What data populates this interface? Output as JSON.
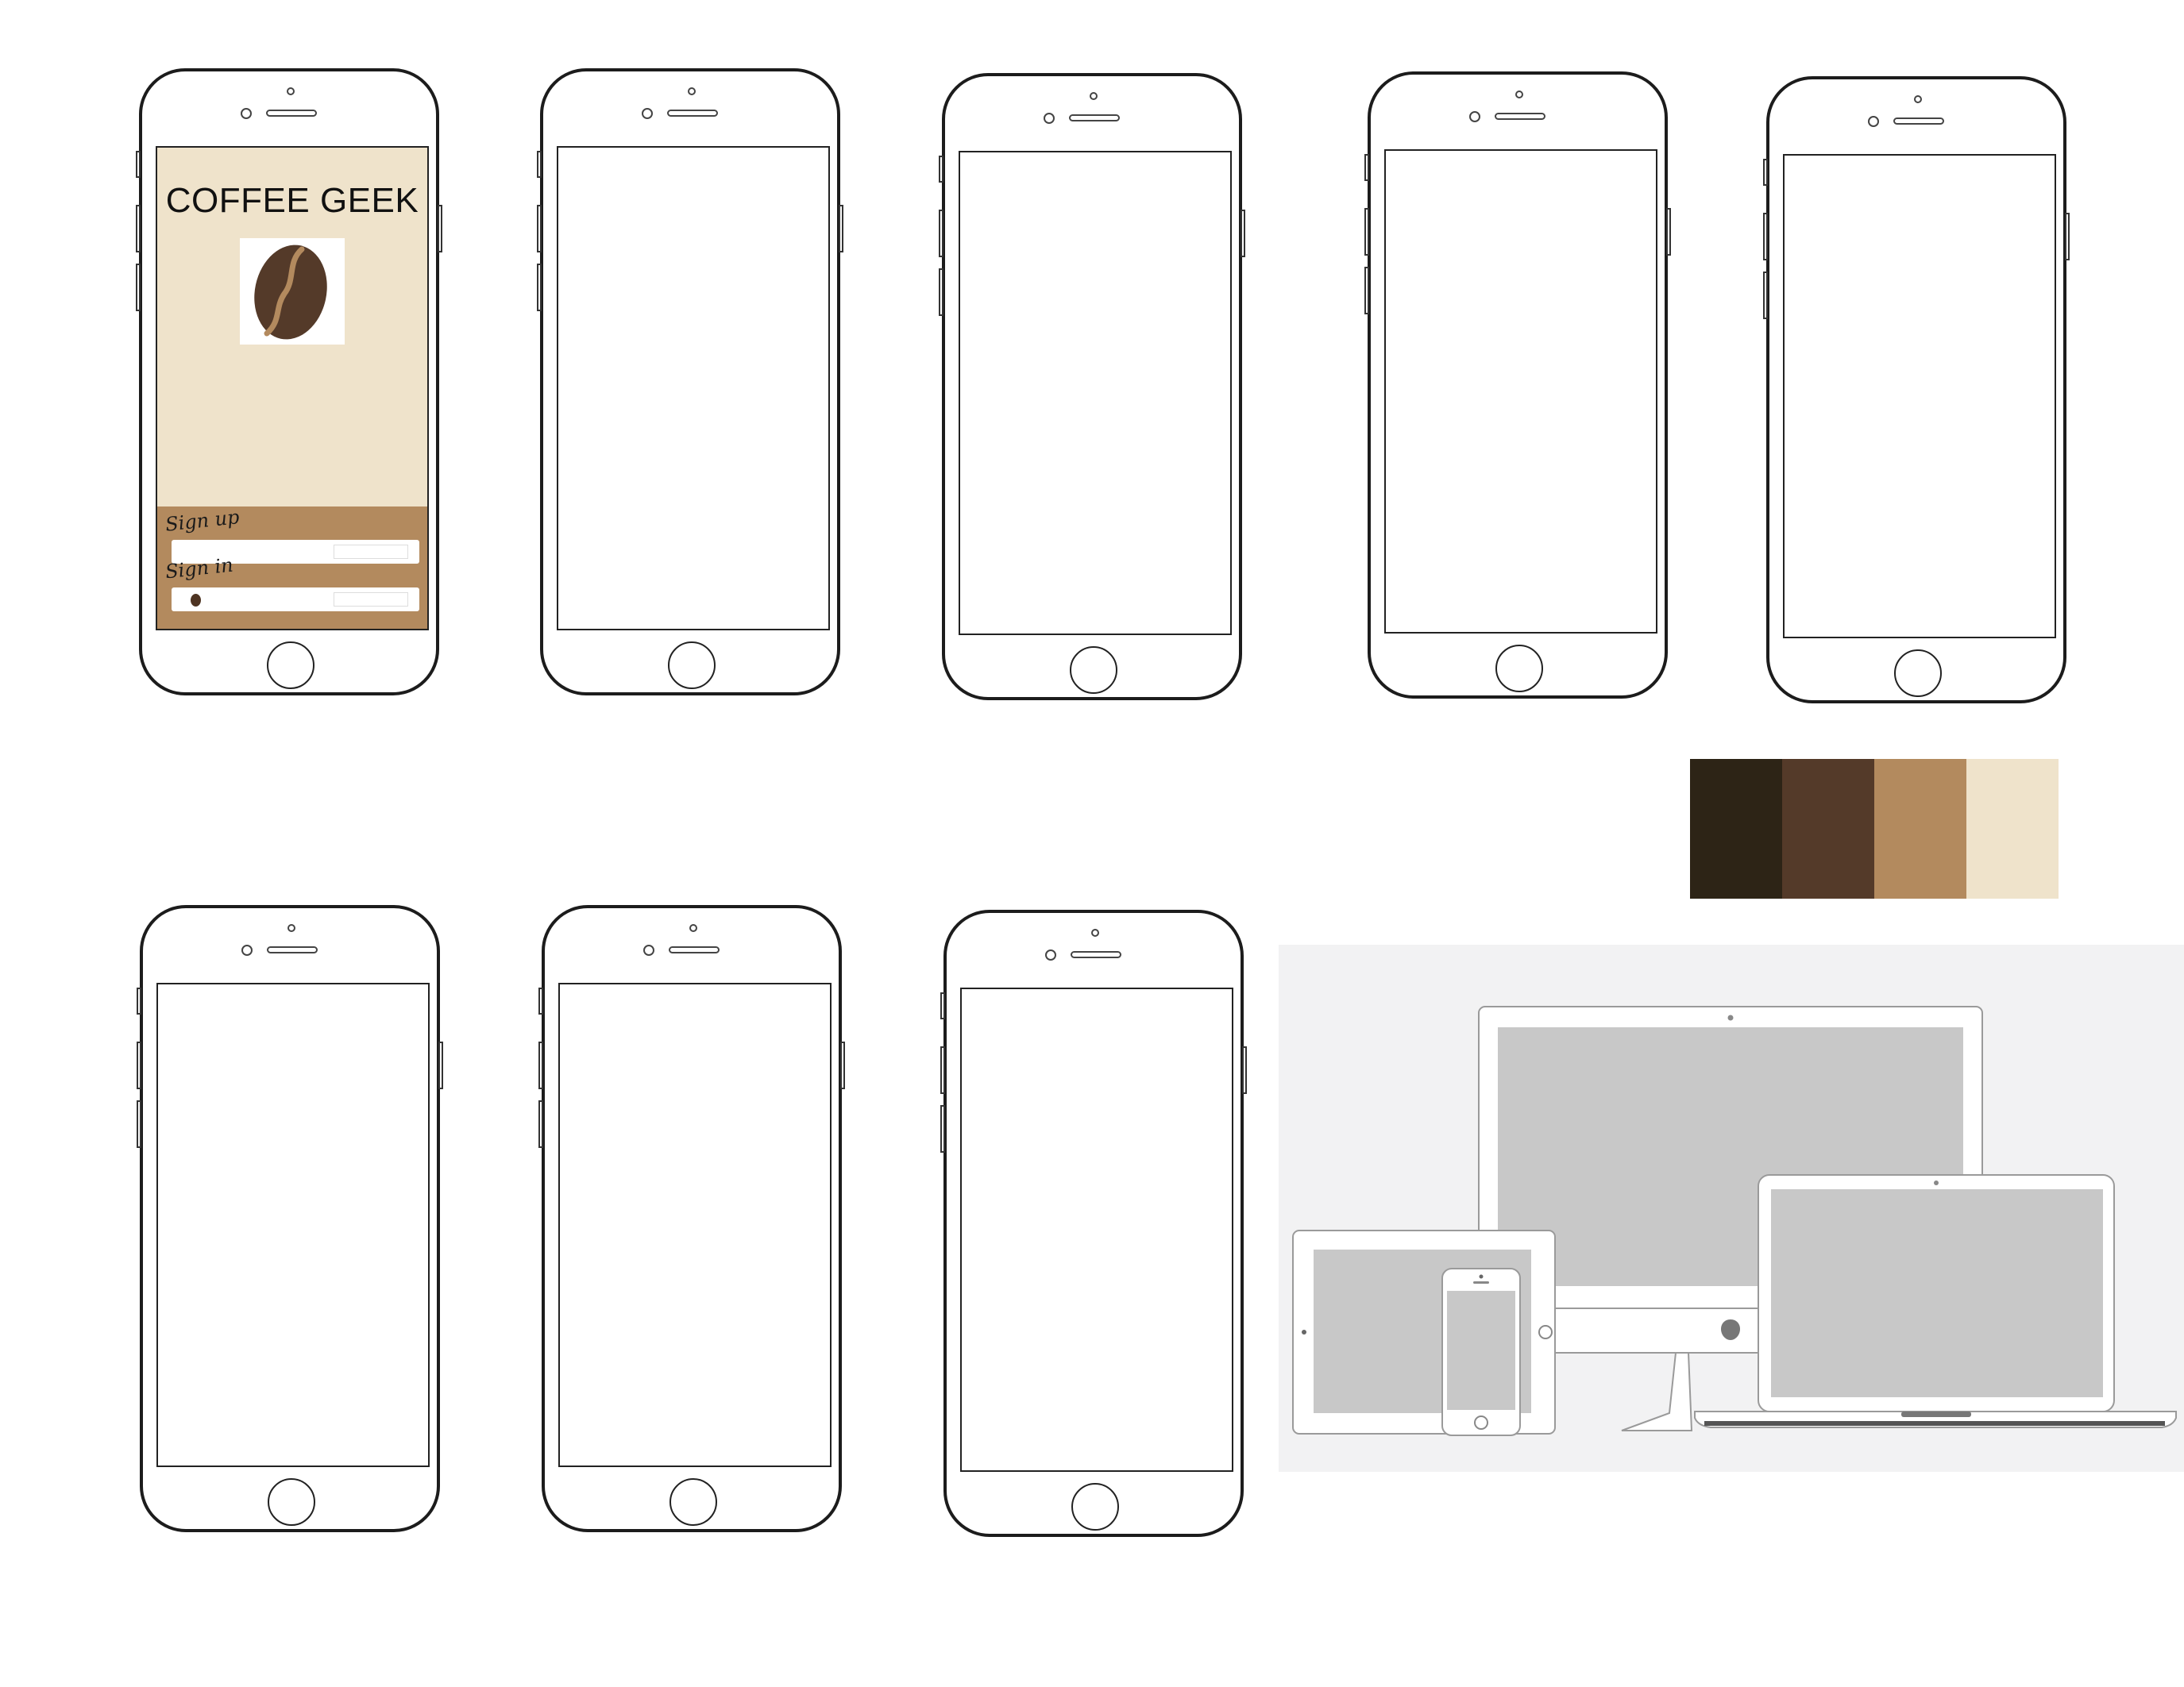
{
  "app": {
    "title": "COFFEE GEEK",
    "sign_up_label": "Sign up",
    "sign_in_label": "Sign in"
  },
  "palette": {
    "colors": [
      "#2d2416",
      "#543a29",
      "#b38a5e",
      "#efe3cb"
    ]
  },
  "icons": {
    "logo": "coffee-bean-icon",
    "devices": "device-mockups-illustration"
  }
}
